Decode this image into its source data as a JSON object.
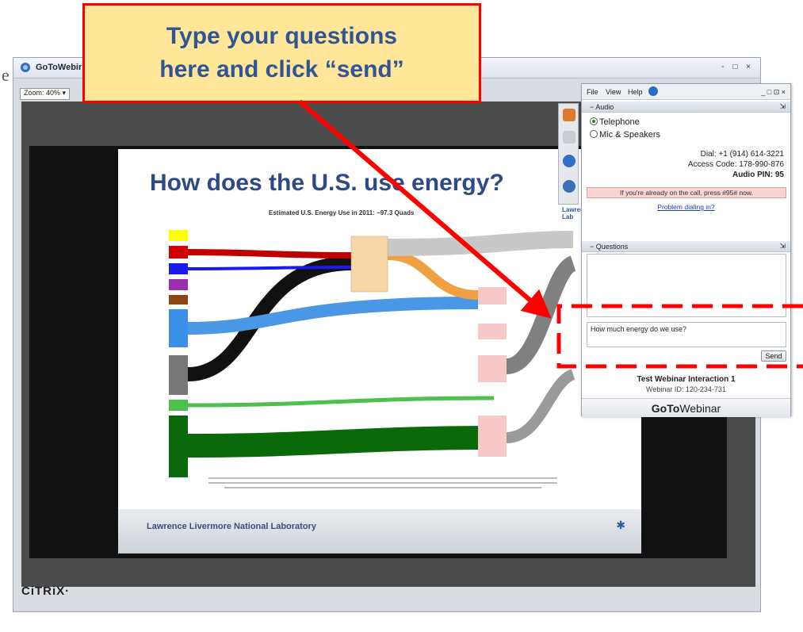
{
  "callout": {
    "line1": "Type your questions",
    "line2": "here and click “send”"
  },
  "window": {
    "title": "GoToWebir",
    "controls": "- □ ×",
    "zoom": "Zoom: 40% ▾",
    "edge_letter": "e"
  },
  "slide": {
    "title": "How does the U.S. use energy?",
    "chart_title": "Estimated U.S. Energy Use in 2011: ~97.3 Quads",
    "lab_logo": "Lawrence Liv National Lab",
    "footer": "Lawrence Livermore National Laboratory"
  },
  "branding": {
    "citrix": "CiTRiX·"
  },
  "panel": {
    "menu": {
      "file": "File",
      "view": "View",
      "help": "Help",
      "win_controls": "_ □ ⊡ ×"
    },
    "audio": {
      "header": "Audio",
      "telephone": "Telephone",
      "mic": "Mic & Speakers",
      "dial": "Dial: +1 (914) 614-3221",
      "access_code": "Access Code: 178-990-876",
      "audio_pin": "Audio PIN: 95",
      "already_on_call": "If you're already on the call, press #95# now.",
      "problem_link": "Problem dialing in?"
    },
    "questions": {
      "header": "Questions",
      "input_value": "How much energy do we use?",
      "send_label": "Send"
    },
    "webinar": {
      "title": "Test Webinar Interaction 1",
      "id": "Webinar ID: 120-234-731"
    },
    "brand": {
      "goto": "GoTo",
      "webinar": "Webinar"
    }
  },
  "colors": {
    "accent_red": "#ff0000",
    "callout_fill": "#ffe699",
    "callout_text": "#2f5597"
  }
}
